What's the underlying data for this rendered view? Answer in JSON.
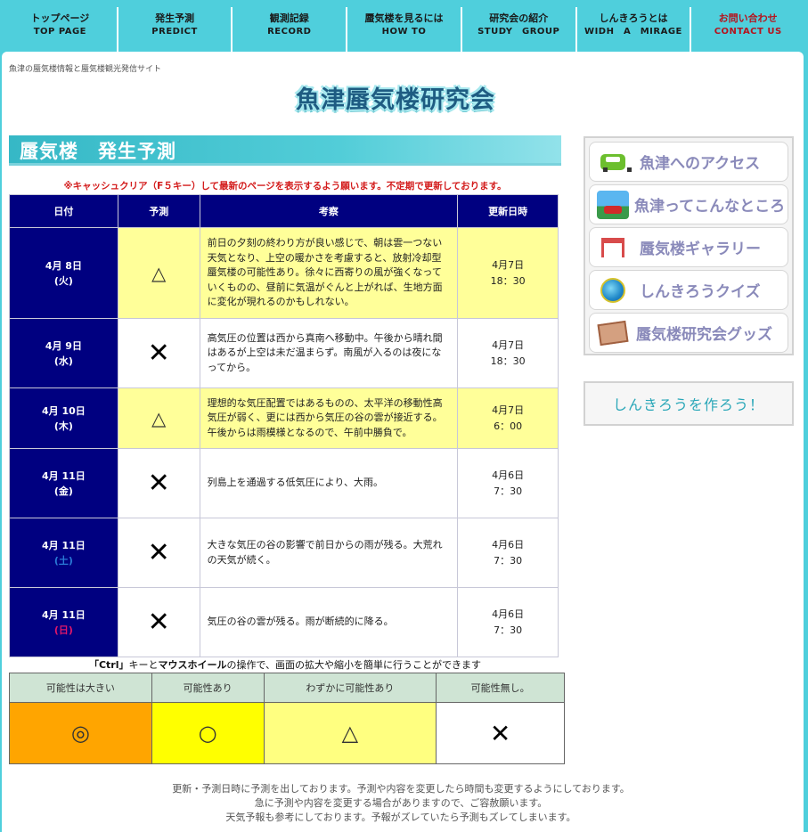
{
  "nav": [
    {
      "jp": "トップページ",
      "en": "TOP PAGE"
    },
    {
      "jp": "発生予測",
      "en": "PREDICT"
    },
    {
      "jp": "観測記録",
      "en": "RECORD"
    },
    {
      "jp": "蜃気楼を見るには",
      "en": "HOW TO"
    },
    {
      "jp": "研究会の紹介",
      "en": "STUDY　GROUP"
    },
    {
      "jp": "しんきろうとは",
      "en": "WIDH　A　MIRAGE"
    },
    {
      "jp": "お問い合わせ",
      "en": "CONTACT US"
    }
  ],
  "header": {
    "tagline": "魚津の蜃気楼情報と蜃気楼観光発信サイト",
    "logo": "魚津蜃気楼研究会"
  },
  "section": {
    "title": "蜃気楼　発生予測"
  },
  "notice": "※キャッシュクリア（F５キー）して最新のページを表示するよう願います。不定期で更新しております。",
  "forecast": {
    "headers": [
      "日付",
      "予測",
      "考察",
      "更新日時"
    ],
    "rows": [
      {
        "date": "4月 8日",
        "dow": "(火)",
        "mark": "△",
        "obs": "前日の夕刻の終わり方が良い感じで、朝は雲一つない天気となり、上空の暖かさを考慮すると、放射冷却型蜃気楼の可能性あり。徐々に西寄りの風が強くなっていくものの、昼前に気温がぐんと上がれば、生地方面に変化が現れるのかもしれない。",
        "upd_date": "4月7日",
        "upd_time": "18：30"
      },
      {
        "date": "4月 9日",
        "dow": "(水)",
        "mark": "✕",
        "obs": "高気圧の位置は西から真南へ移動中。午後から晴れ間はあるが上空は未だ温まらず。南風が入るのは夜になってから。",
        "upd_date": "4月7日",
        "upd_time": "18：30"
      },
      {
        "date": "4月 10日",
        "dow": "(木)",
        "mark": "△",
        "obs": "理想的な気圧配置ではあるものの、太平洋の移動性高気圧が弱く、更には西から気圧の谷の雲が接近する。午後からは雨模様となるので、午前中勝負で。",
        "upd_date": "4月7日",
        "upd_time": "6：00"
      },
      {
        "date": "4月 11日",
        "dow": "(金)",
        "mark": "✕",
        "obs": "列島上を通過する低気圧により、大雨。",
        "upd_date": "4月6日",
        "upd_time": "7：30"
      },
      {
        "date": "4月 11日",
        "dow": "(土)",
        "mark": "✕",
        "obs": "大きな気圧の谷の影響で前日からの雨が残る。大荒れの天気が続く。",
        "upd_date": "4月6日",
        "upd_time": "7：30"
      },
      {
        "date": "4月 11日",
        "dow": "(日)",
        "mark": "✕",
        "obs": "気圧の谷の雲が残る。雨が断続的に降る。",
        "upd_date": "4月6日",
        "upd_time": "7：30"
      }
    ]
  },
  "ctrl_note": {
    "k1": "「Ctrl」",
    "t1": "キーと",
    "k2": "マウスホイール",
    "t2": "の操作で、画面の拡大や縮小を簡単に行うことができます"
  },
  "legend": {
    "headers": [
      "可能性は大きい",
      "可能性あり",
      "わずかに可能性あり",
      "可能性無し。"
    ],
    "marks": [
      "◎",
      "○",
      "△",
      "✕"
    ],
    "colors": [
      "#ffa500",
      "#ffff00",
      "#ffff80",
      "#ffffff"
    ]
  },
  "footer": [
    "更新・予測日時に予測を出しております。予測や内容を変更したら時間も変更するようにしております。",
    "急に予測や内容を変更する場合がありますので、ご容赦願います。",
    "天気予報も参考にしております。予報がズレていたら予測もズレてしまいます。"
  ],
  "side_menu": [
    {
      "label": "魚津へのアクセス",
      "icon": "car-icon"
    },
    {
      "label": "魚津ってこんなところ",
      "icon": "town-icon"
    },
    {
      "label": "蜃気楼ギャラリー",
      "icon": "gate-icon"
    },
    {
      "label": "しんきろうクイズ",
      "icon": "globe-icon"
    },
    {
      "label": "蜃気楼研究会グッズ",
      "icon": "goods-icon"
    }
  ],
  "make_mirage": "しんきろうを作ろう！"
}
